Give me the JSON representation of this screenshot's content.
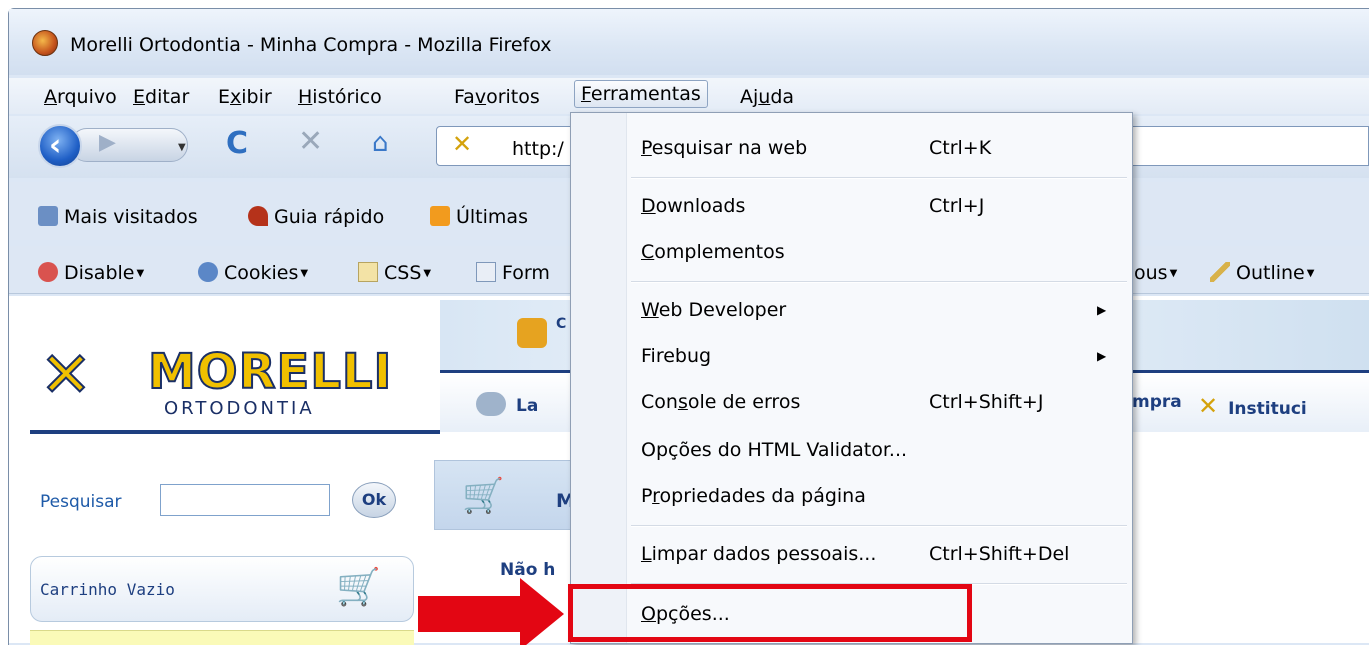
{
  "window": {
    "title": "Morelli Ortodontia - Minha Compra - Mozilla Firefox"
  },
  "menubar": {
    "items": [
      {
        "label": "Arquivo",
        "mnemonic": "A",
        "rest": "rquivo"
      },
      {
        "label": "Editar",
        "mnemonic": "E",
        "rest": "ditar"
      },
      {
        "label": "Exibir",
        "prefix": "E",
        "mnemonic": "x",
        "rest": "ibir"
      },
      {
        "label": "Histórico",
        "mnemonic": "H",
        "rest": "istórico"
      },
      {
        "label": "Favoritos",
        "prefix": "Fa",
        "mnemonic": "v",
        "rest": "oritos"
      },
      {
        "label": "Ferramentas",
        "mnemonic": "F",
        "rest": "erramentas"
      },
      {
        "label": "Ajuda",
        "prefix": "Aj",
        "mnemonic": "u",
        "rest": "da"
      }
    ]
  },
  "navbar": {
    "url": "http:/"
  },
  "bookmarks": {
    "items": [
      {
        "label": "Mais visitados"
      },
      {
        "label": "Guia rápido"
      },
      {
        "label": "Últimas"
      }
    ]
  },
  "devbar": {
    "items": [
      {
        "label": "Disable"
      },
      {
        "label": "Cookies"
      },
      {
        "label": "CSS"
      },
      {
        "label": "Form"
      },
      {
        "label": "ous"
      },
      {
        "label": "Outline"
      }
    ]
  },
  "site": {
    "logo": {
      "brand": "MORELLI",
      "subtitle": "ORTODONTIA"
    },
    "nav": [
      {
        "label": "La"
      },
      {
        "label": "mpra"
      },
      {
        "label": "Instituci"
      }
    ],
    "user_initial": "C",
    "search": {
      "label": "Pesquisar",
      "button": "Ok"
    },
    "cart": {
      "label": "Carrinho Vazio"
    },
    "cart_panel_letter": "M",
    "message": "Não h"
  },
  "tools_menu": {
    "items": [
      {
        "mnemonic": "P",
        "rest": "esquisar na web",
        "shortcut": "Ctrl+K"
      },
      {
        "mnemonic": "D",
        "rest": "ownloads",
        "shortcut": "Ctrl+J"
      },
      {
        "mnemonic": "C",
        "rest": "omplementos",
        "shortcut": ""
      },
      {
        "mnemonic": "W",
        "rest": "eb Developer",
        "shortcut": ""
      },
      {
        "mnemonic": "",
        "rest": "Firebug",
        "shortcut": ""
      },
      {
        "prefix": "Con",
        "mnemonic": "s",
        "rest": "ole de erros",
        "shortcut": "Ctrl+Shift+J"
      },
      {
        "mnemonic": "",
        "rest": "Opções do HTML Validator...",
        "shortcut": ""
      },
      {
        "prefix": "P",
        "mnemonic": "r",
        "rest": "opriedades da página",
        "shortcut": ""
      },
      {
        "mnemonic": "L",
        "rest": "impar dados pessoais...",
        "shortcut": "Ctrl+Shift+Del"
      },
      {
        "mnemonic": "O",
        "rest": "pções...",
        "shortcut": ""
      }
    ]
  },
  "annotation": {
    "color": "#e30613"
  }
}
